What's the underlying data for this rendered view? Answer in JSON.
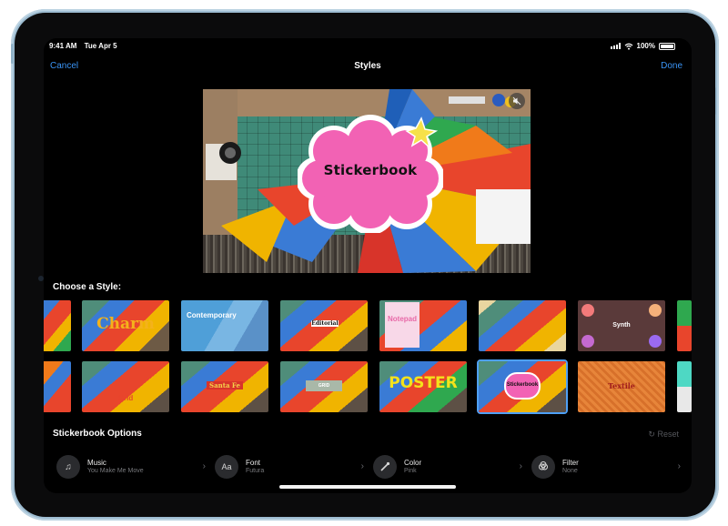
{
  "status_bar": {
    "time": "9:41 AM",
    "date": "Tue Apr 5",
    "battery": "100%"
  },
  "nav": {
    "cancel": "Cancel",
    "title": "Styles",
    "done": "Done"
  },
  "preview": {
    "sticker_text": "Stickerbook",
    "mute_icon": "speaker-muted-icon"
  },
  "choose_label": "Choose a Style:",
  "styles_row1": [
    {
      "label": ""
    },
    {
      "label": "Charm"
    },
    {
      "label": "Contemporary"
    },
    {
      "label": "Editorial"
    },
    {
      "label": "Notepad"
    },
    {
      "label": ""
    },
    {
      "label": "Synth"
    },
    {
      "label": ""
    }
  ],
  "styles_row2": [
    {
      "label": ""
    },
    {
      "label": "Grid"
    },
    {
      "label": "Santa Fe"
    },
    {
      "label": "GRID"
    },
    {
      "label": "POSTER"
    },
    {
      "label": "Stickerbook"
    },
    {
      "label": "Textile"
    },
    {
      "label": ""
    }
  ],
  "options": {
    "title": "Stickerbook Options",
    "reset": "Reset",
    "items": [
      {
        "name": "Music",
        "value": "You Make Me Move",
        "icon": "music-note-icon"
      },
      {
        "name": "Font",
        "value": "Futura",
        "icon": "font-aa-icon"
      },
      {
        "name": "Color",
        "value": "Pink",
        "icon": "eyedropper-icon"
      },
      {
        "name": "Filter",
        "value": "None",
        "icon": "filter-circles-icon"
      }
    ]
  },
  "colors": {
    "accent": "#3a94f5",
    "sticker_pink": "#f262b4",
    "selected_outline": "#4ea0f5"
  }
}
